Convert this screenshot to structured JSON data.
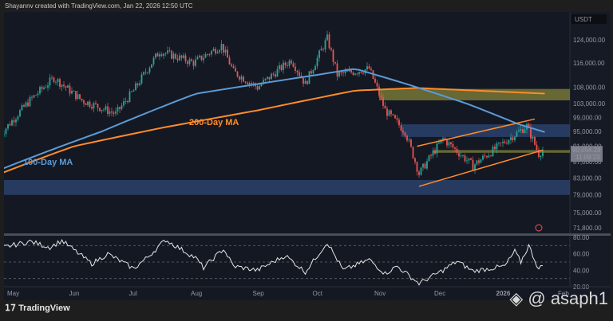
{
  "header": {
    "caption": "Shayannv created with TradingView.com, Jan 22, 2026 12:50 UTC"
  },
  "footer": {
    "logo": "TradingView",
    "watermark": "@ asaph1"
  },
  "chart_data": {
    "type": "candlestick",
    "currency": "USDT",
    "y_scale": "log",
    "price_ticks": [
      124000,
      116000,
      108000,
      103000,
      99000,
      95000,
      91000,
      87000,
      83000,
      79000,
      75000,
      71800
    ],
    "price_tick_labels": [
      "124,000.00",
      "116,000.00",
      "108,000.00",
      "103,000.00",
      "99,000.00",
      "95,000.00",
      "91,000.00",
      "87,000.00",
      "83,000.00",
      "79,000.00",
      "75,000.00",
      "71,800.00"
    ],
    "last_price": "90,054.28",
    "countdown": "11:09:23",
    "x_ticks": [
      "May",
      "Jun",
      "Jul",
      "Aug",
      "Sep",
      "Oct",
      "Nov",
      "Dec",
      "2026",
      "Feb"
    ],
    "x_tick_dates": [
      "2025-05-01",
      "2025-06-01",
      "2025-07-01",
      "2025-08-01",
      "2025-09-01",
      "2025-10-01",
      "2025-11-01",
      "2025-12-01",
      "2026-01-01",
      "2026-02-01"
    ],
    "price_path": [
      [
        "2025-04-25",
        94000
      ],
      [
        "2025-05-10",
        104000
      ],
      [
        "2025-05-22",
        111000
      ],
      [
        "2025-06-05",
        104000
      ],
      [
        "2025-06-22",
        100000
      ],
      [
        "2025-07-01",
        107000
      ],
      [
        "2025-07-14",
        120000
      ],
      [
        "2025-07-31",
        116000
      ],
      [
        "2025-08-14",
        122000
      ],
      [
        "2025-08-20",
        113000
      ],
      [
        "2025-09-01",
        108000
      ],
      [
        "2025-09-18",
        117000
      ],
      [
        "2025-09-25",
        109000
      ],
      [
        "2025-10-06",
        124500
      ],
      [
        "2025-10-11",
        112000
      ],
      [
        "2025-10-27",
        114000
      ],
      [
        "2025-11-04",
        101000
      ],
      [
        "2025-11-14",
        95000
      ],
      [
        "2025-11-21",
        84000
      ],
      [
        "2025-12-03",
        93000
      ],
      [
        "2025-12-18",
        86000
      ],
      [
        "2026-01-05",
        93000
      ],
      [
        "2026-01-14",
        96500
      ],
      [
        "2026-01-20",
        89000
      ],
      [
        "2026-01-22",
        90054
      ]
    ],
    "ma100": {
      "label": "100-Day MA",
      "color": "#5b9bd5",
      "path": [
        [
          "2025-04-25",
          85000
        ],
        [
          "2025-06-15",
          95000
        ],
        [
          "2025-08-01",
          106000
        ],
        [
          "2025-10-01",
          112000
        ],
        [
          "2025-10-20",
          114000
        ],
        [
          "2025-11-15",
          109000
        ],
        [
          "2025-12-15",
          103000
        ],
        [
          "2026-01-10",
          97000
        ],
        [
          "2026-01-25",
          94500
        ]
      ]
    },
    "ma200": {
      "label": "200-Day MA",
      "color": "#ff8c2b",
      "path": [
        [
          "2025-04-25",
          84000
        ],
        [
          "2025-06-01",
          91000
        ],
        [
          "2025-07-15",
          96000
        ],
        [
          "2025-09-01",
          101000
        ],
        [
          "2025-10-20",
          107000
        ],
        [
          "2025-11-20",
          107800
        ],
        [
          "2026-01-25",
          106000
        ]
      ]
    },
    "zones": [
      {
        "from": "2025-11-01",
        "low": 104000,
        "high": 107500,
        "color": "#8a8a3a"
      },
      {
        "from": "2025-11-12",
        "low": 93500,
        "high": 97000,
        "color": "#2f4a7a"
      },
      {
        "from": "2025-11-28",
        "low": 89300,
        "high": 90000,
        "color": "#8a8a3a"
      },
      {
        "from": "2025-04-25",
        "low": 79000,
        "high": 82500,
        "color": "#2f4a7a"
      }
    ],
    "wedge": [
      {
        "from": [
          "2025-11-20",
          91000
        ],
        "to": [
          "2026-01-18",
          98500
        ]
      },
      {
        "from": [
          "2025-11-21",
          81000
        ],
        "to": [
          "2026-01-22",
          90000
        ]
      }
    ],
    "rsi": {
      "ticks": [
        80,
        60,
        40,
        20
      ],
      "tick_labels": [
        "80.00",
        "60.00",
        "40.00",
        "20.00"
      ],
      "levels": [
        70,
        50,
        30
      ],
      "path": [
        [
          "2025-04-25",
          67
        ],
        [
          "2025-05-10",
          75
        ],
        [
          "2025-05-20",
          68
        ],
        [
          "2025-05-26",
          76
        ],
        [
          "2025-06-10",
          48
        ],
        [
          "2025-06-18",
          60
        ],
        [
          "2025-07-01",
          42
        ],
        [
          "2025-07-08",
          56
        ],
        [
          "2025-07-17",
          77
        ],
        [
          "2025-08-01",
          55
        ],
        [
          "2025-08-05",
          43
        ],
        [
          "2025-08-15",
          66
        ],
        [
          "2025-08-20",
          45
        ],
        [
          "2025-09-01",
          40
        ],
        [
          "2025-09-15",
          58
        ],
        [
          "2025-09-25",
          38
        ],
        [
          "2025-10-06",
          74
        ],
        [
          "2025-10-14",
          40
        ],
        [
          "2025-10-27",
          53
        ],
        [
          "2025-11-04",
          36
        ],
        [
          "2025-11-10",
          45
        ],
        [
          "2025-11-21",
          24
        ],
        [
          "2025-12-03",
          40
        ],
        [
          "2025-12-10",
          51
        ],
        [
          "2025-12-18",
          39
        ],
        [
          "2026-01-03",
          45
        ],
        [
          "2026-01-08",
          63
        ],
        [
          "2026-01-11",
          50
        ],
        [
          "2026-01-15",
          70
        ],
        [
          "2026-01-20",
          41
        ],
        [
          "2026-01-22",
          46
        ]
      ]
    }
  }
}
